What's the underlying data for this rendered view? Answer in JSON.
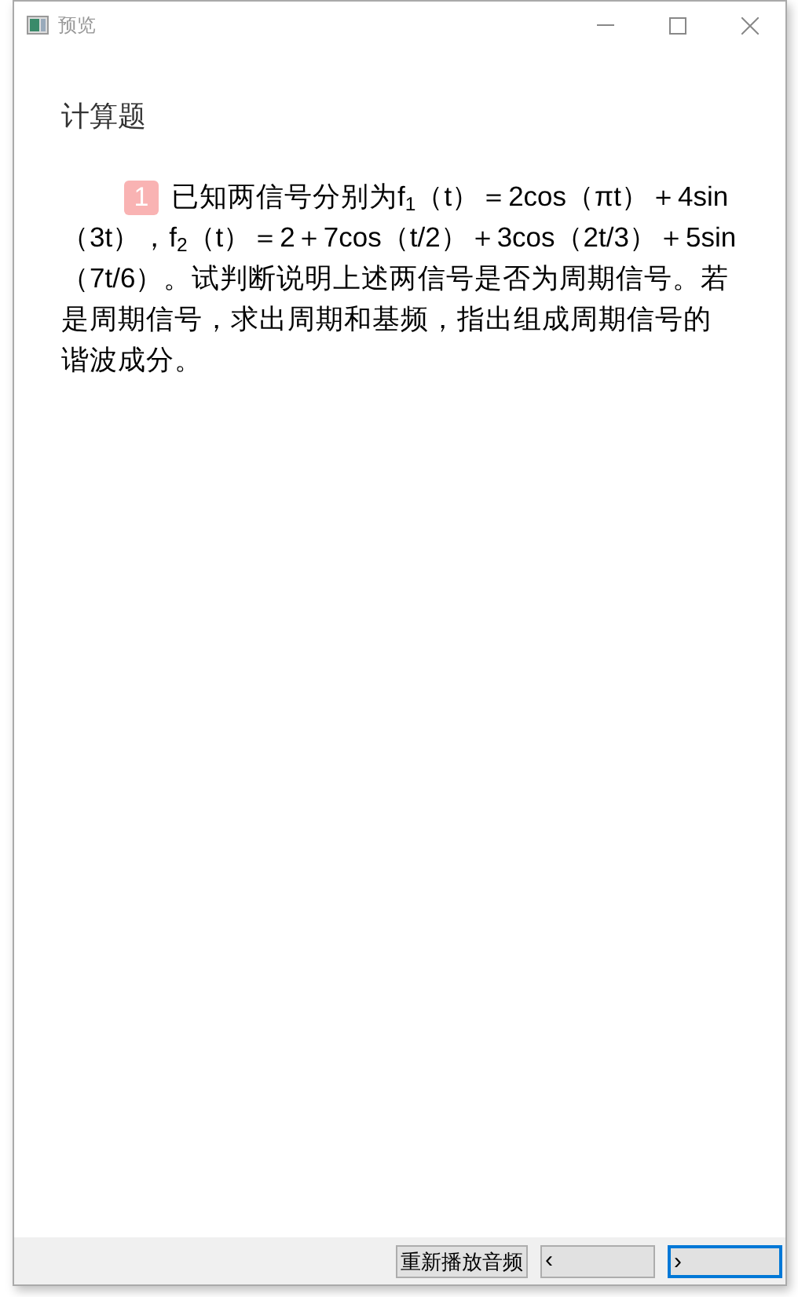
{
  "window": {
    "title": "预览"
  },
  "section_title": "计算题",
  "question": {
    "number": "1",
    "text": "已知两信号分别为f$_{1}$（t）＝2cos（πt）＋4sin（3t），f$_{2}$（t）＝2＋7cos（t/2）＋3cos（2t/3）＋5sin（7t/6）。试判断说明上述两信号是否为周期信号。若是周期信号，求出周期和基频，指出组成周期信号的谐波成分。"
  },
  "buttons": [
    {
      "label": "重新播放音频",
      "focused": false
    },
    {
      "label": "‹",
      "focused": false
    },
    {
      "label": "›",
      "focused": true
    }
  ]
}
